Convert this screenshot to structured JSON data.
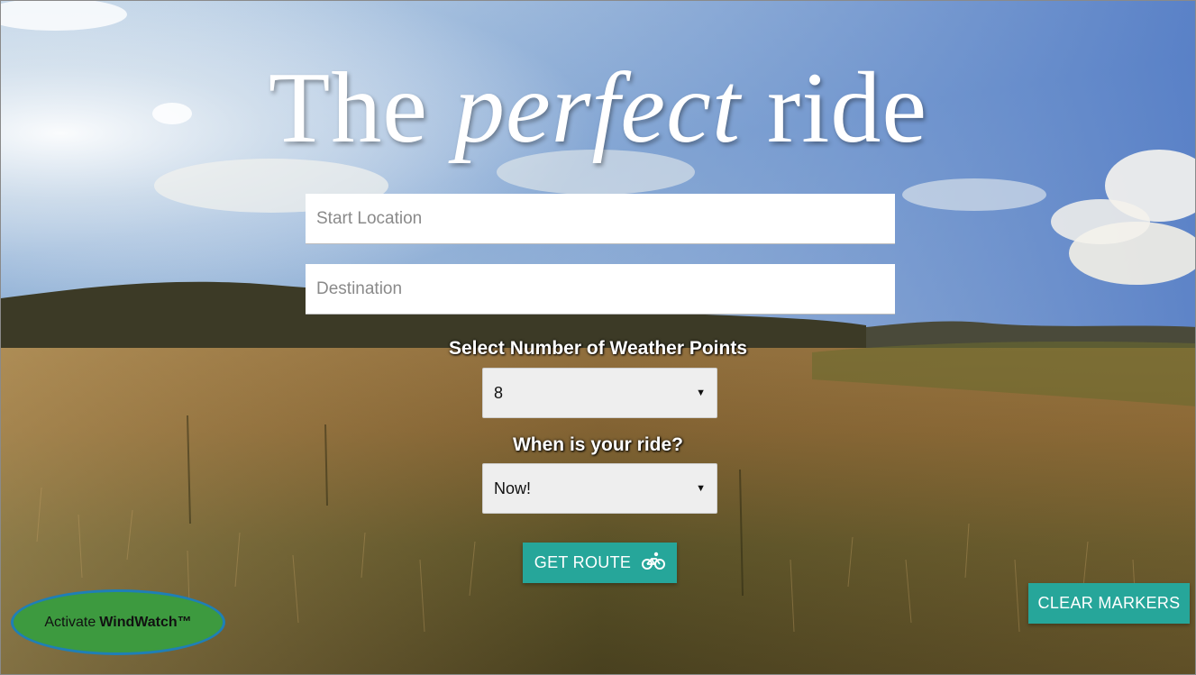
{
  "hero": {
    "title_part1": "The ",
    "title_emphasis": "perfect",
    "title_part2": " ride"
  },
  "form": {
    "start_placeholder": "Start Location",
    "destination_placeholder": "Destination",
    "points_label": "Select Number of Weather Points",
    "points_value": "8",
    "when_label": "When is your ride?",
    "when_value": "Now!",
    "route_button_label": "GET ROUTE",
    "route_icon": "bicycle-icon"
  },
  "controls": {
    "clear_label": "CLEAR MARKERS",
    "windwatch_prefix": "Activate",
    "windwatch_name": "WindWatch™"
  },
  "colors": {
    "accent": "#26a69a",
    "windwatch_fill": "#3d9a3f",
    "windwatch_border": "#1f7fb6"
  }
}
